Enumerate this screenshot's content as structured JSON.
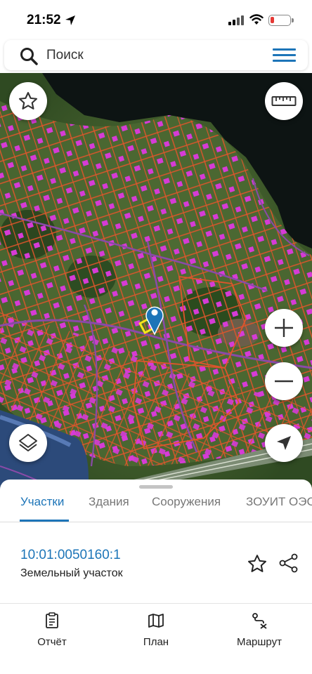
{
  "status_bar": {
    "time": "21:52"
  },
  "search": {
    "placeholder": "Поиск"
  },
  "map": {
    "buttons": [
      "favorites-star",
      "ruler",
      "zoom-in",
      "zoom-out",
      "layers",
      "my-location"
    ],
    "parcel_outline_color": "#e0552b",
    "building_color": "#d63bd6",
    "road_color": "#8a4aa8",
    "marker_color": "#1d75b8",
    "selected_parcel_color": "#f5e51b"
  },
  "tabs": [
    {
      "label": "Участки",
      "active": true
    },
    {
      "label": "Здания",
      "active": false
    },
    {
      "label": "Сооружения",
      "active": false
    },
    {
      "label": "ЗОУИТ ОЭС",
      "active": false
    }
  ],
  "result": {
    "number": "10:01:0050160:1",
    "type": "Земельный участок"
  },
  "bottom_nav": [
    {
      "label": "Отчёт",
      "icon": "report-icon"
    },
    {
      "label": "План",
      "icon": "map-plan-icon"
    },
    {
      "label": "Маршрут",
      "icon": "route-icon"
    }
  ],
  "colors": {
    "accent": "#1d75b8"
  }
}
